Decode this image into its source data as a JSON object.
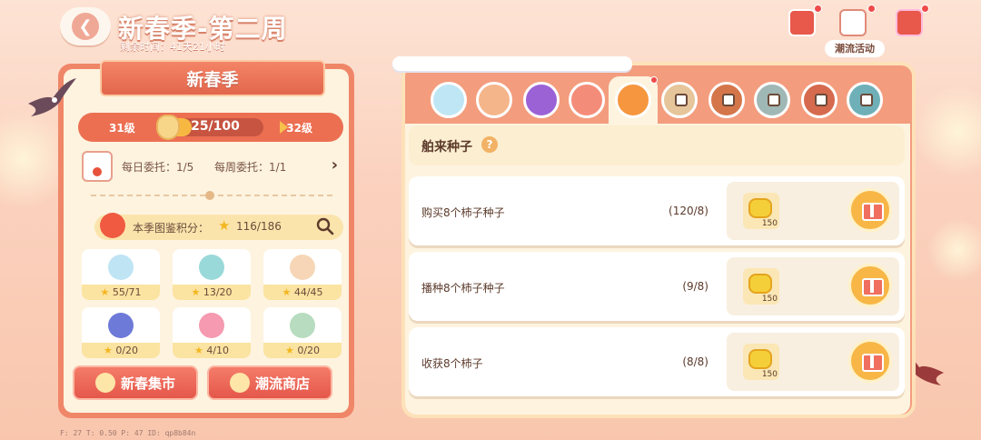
{
  "header": {
    "title": "新春季-第二周",
    "remaining": "剩余时间：41天21小时",
    "activity_label": "潮流活动"
  },
  "left": {
    "season_title": "新春季",
    "level": {
      "current": "31级",
      "next": "32级",
      "progress_text": "25/100",
      "progress": 0.25
    },
    "commission": {
      "daily": "每日委托：1/5",
      "weekly": "每周委托：1/1"
    },
    "score": {
      "label": "本季图鉴积分：",
      "value": "116/186"
    },
    "collections": [
      {
        "icon": "seal-icon",
        "value": "55/71"
      },
      {
        "icon": "fish-icon",
        "value": "13/20"
      },
      {
        "icon": "dumpling-icon",
        "value": "44/45"
      },
      {
        "icon": "butterfly-icon",
        "value": "0/20"
      },
      {
        "icon": "candy-icon",
        "value": "4/10"
      },
      {
        "icon": "bird-icon",
        "value": "0/20"
      }
    ],
    "buttons": {
      "market": "新春集市",
      "shop": "潮流商店"
    }
  },
  "right": {
    "section_title": "舶来种子",
    "help": "?",
    "tasks": [
      {
        "name": "购买8个柿子种子",
        "progress": "(120/8)",
        "reward_qty": "150"
      },
      {
        "name": "播种8个柿子种子",
        "progress": "(9/8)",
        "reward_qty": "150"
      },
      {
        "name": "收获8个柿子",
        "progress": "(8/8)",
        "reward_qty": "150"
      }
    ]
  },
  "debug": "F: 27   T: 0.50   P: 47   ID: qp8b84n",
  "colors": {
    "accent": "#f08668",
    "panel": "#fdf3df",
    "gold": "#f7b842"
  }
}
